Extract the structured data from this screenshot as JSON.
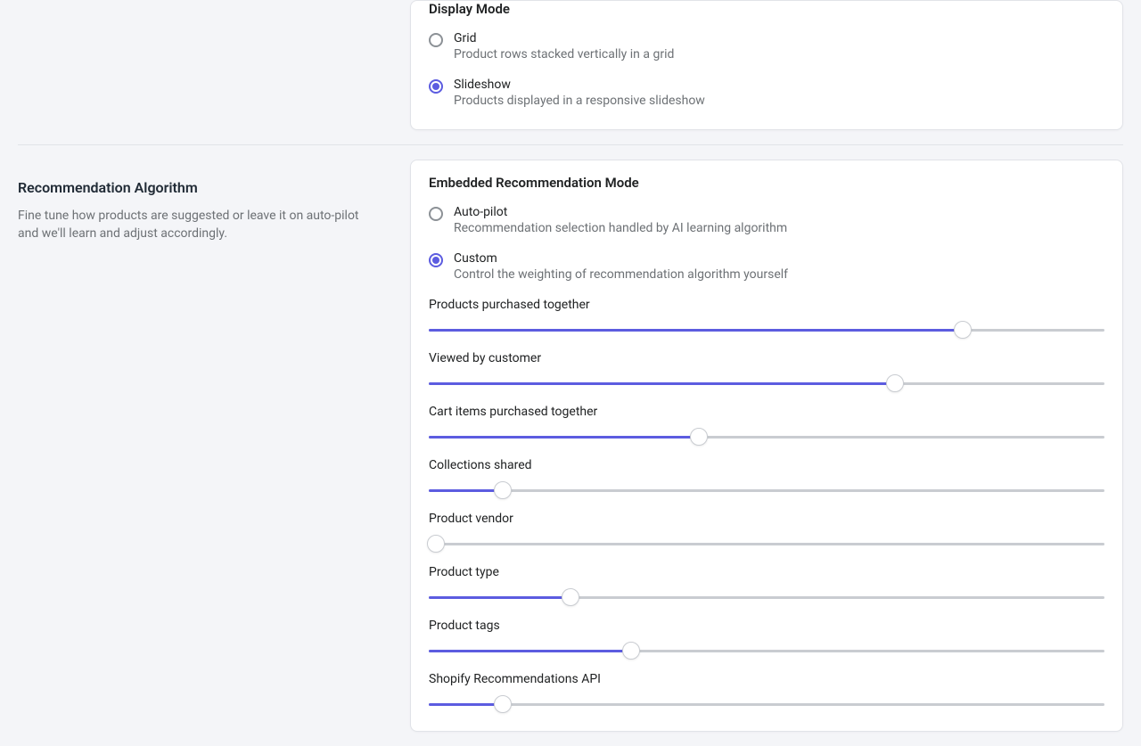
{
  "displayMode": {
    "heading": "Display Mode",
    "options": [
      {
        "label": "Grid",
        "desc": "Product rows stacked vertically in a grid",
        "selected": false
      },
      {
        "label": "Slideshow",
        "desc": "Products displayed in a responsive slideshow",
        "selected": true
      }
    ]
  },
  "recommendation": {
    "title": "Recommendation Algorithm",
    "description": "Fine tune how products are suggested or leave it on auto-pilot and we'll learn and adjust accordingly.",
    "modeHeading": "Embedded Recommendation Mode",
    "options": [
      {
        "label": "Auto-pilot",
        "desc": "Recommendation selection handled by AI learning algorithm",
        "selected": false
      },
      {
        "label": "Custom",
        "desc": "Control the weighting of recommendation algorithm yourself",
        "selected": true
      }
    ],
    "sliders": [
      {
        "label": "Products purchased together",
        "value": 79
      },
      {
        "label": "Viewed by customer",
        "value": 69
      },
      {
        "label": "Cart items purchased together",
        "value": 40
      },
      {
        "label": "Collections shared",
        "value": 11
      },
      {
        "label": "Product vendor",
        "value": 1
      },
      {
        "label": "Product type",
        "value": 21
      },
      {
        "label": "Product tags",
        "value": 30
      },
      {
        "label": "Shopify Recommendations API",
        "value": 11
      }
    ]
  }
}
